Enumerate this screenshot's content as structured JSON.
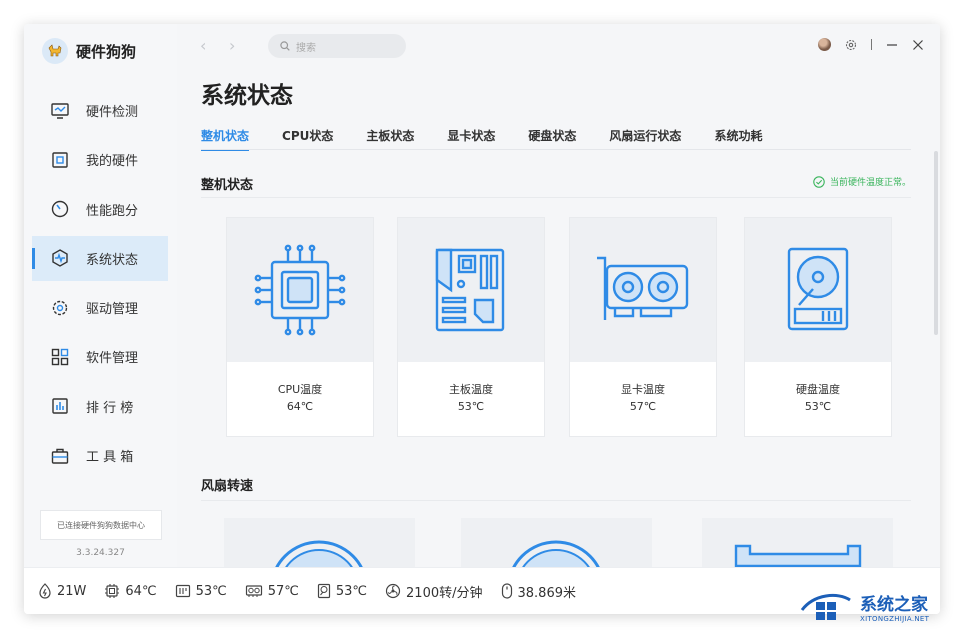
{
  "app": {
    "name": "硬件狗狗",
    "version": "3.3.24.327"
  },
  "sidebar": {
    "items": [
      {
        "label": "硬件检测",
        "icon": "monitor-icon"
      },
      {
        "label": "我的硬件",
        "icon": "hardware-icon"
      },
      {
        "label": "性能跑分",
        "icon": "gauge-icon"
      },
      {
        "label": "系统状态",
        "icon": "heartbeat-icon",
        "active": true
      },
      {
        "label": "驱动管理",
        "icon": "gear-icon"
      },
      {
        "label": "软件管理",
        "icon": "apps-grid-icon"
      },
      {
        "label": "排 行 榜",
        "icon": "ranking-icon"
      },
      {
        "label": "工 具 箱",
        "icon": "toolbox-icon"
      }
    ],
    "connection_status": "已连接硬件狗狗数据中心"
  },
  "topbar": {
    "search_placeholder": "搜索"
  },
  "page": {
    "title": "系统状态",
    "tabs": [
      "整机状态",
      "CPU状态",
      "主板状态",
      "显卡状态",
      "硬盘状态",
      "风扇运行状态",
      "系统功耗"
    ],
    "active_tab": 0
  },
  "overview": {
    "title": "整机状态",
    "status_text": "当前硬件温度正常。",
    "cards": [
      {
        "label": "CPU温度",
        "value": "64℃",
        "icon": "cpu-icon"
      },
      {
        "label": "主板温度",
        "value": "53℃",
        "icon": "motherboard-icon"
      },
      {
        "label": "显卡温度",
        "value": "57℃",
        "icon": "graphics-card-icon"
      },
      {
        "label": "硬盘温度",
        "value": "53℃",
        "icon": "hard-disk-icon"
      }
    ]
  },
  "fans": {
    "title": "风扇转速"
  },
  "statusbar": {
    "power": "21W",
    "cpu_temp": "64℃",
    "board_temp": "53℃",
    "gpu_temp": "57℃",
    "disk_temp": "53℃",
    "fan_speed": "2100转/分钟",
    "mouse_distance": "38.869米"
  },
  "watermark": {
    "title": "系统之家",
    "url": "XITONGZHIJIA.NET"
  },
  "colors": {
    "accent": "#2f8be6",
    "ok": "#3bb55d",
    "icon": "#2f8be6"
  }
}
